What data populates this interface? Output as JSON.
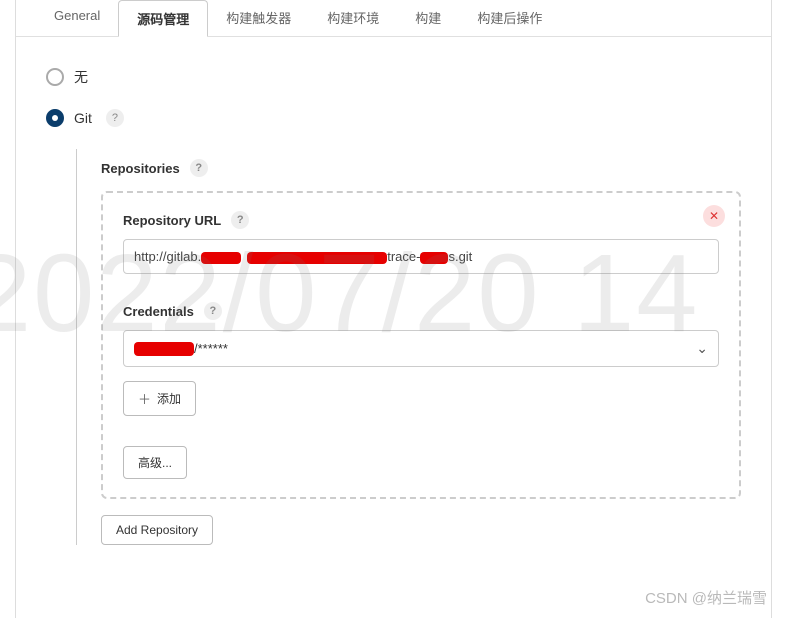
{
  "tabs": {
    "general": "General",
    "scm": "源码管理",
    "triggers": "构建触发器",
    "env": "构建环境",
    "build": "构建",
    "postbuild": "构建后操作"
  },
  "radios": {
    "none": "无",
    "git": "Git"
  },
  "sections": {
    "repositories": "Repositories",
    "repo_url_label": "Repository URL",
    "credentials_label": "Credentials"
  },
  "repo_url": {
    "prefix": "http://gitlab.",
    "mid": "trace-",
    "suffix": "s.git"
  },
  "credentials": {
    "suffix": "/******"
  },
  "buttons": {
    "add": "添加",
    "advanced": "高级...",
    "add_repo": "Add Repository"
  },
  "help_char": "?",
  "watermark": "2022/07/20 14",
  "csdn": "CSDN @纳兰瑞雪"
}
